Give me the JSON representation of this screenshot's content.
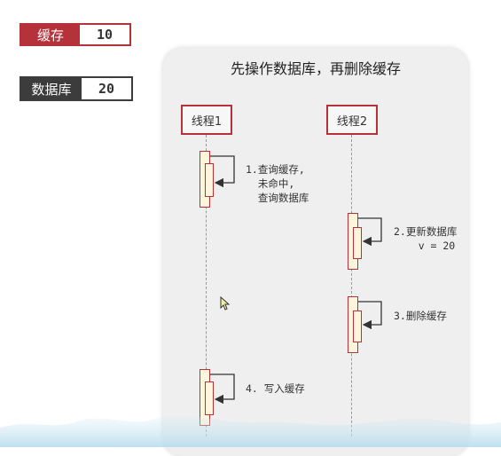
{
  "badges": {
    "cache": {
      "label": "缓存",
      "value": "10"
    },
    "db": {
      "label": "数据库",
      "value": "20"
    }
  },
  "diagram": {
    "title": "先操作数据库，再删除缓存",
    "actors": [
      "线程1",
      "线程2"
    ],
    "steps": [
      {
        "actor": 0,
        "text": "1.查询缓存,\n  未命中,\n  查询数据库"
      },
      {
        "actor": 1,
        "text": "2.更新数据库\n    v = 20"
      },
      {
        "actor": 1,
        "text": "3.删除缓存"
      },
      {
        "actor": 0,
        "text": "4. 写入缓存"
      }
    ]
  },
  "colors": {
    "accent": "#b5323a",
    "dark": "#3c3c3c",
    "activation_fill": "#fff4dc"
  },
  "icons": {
    "cursor": "mouse-pointer-icon"
  }
}
